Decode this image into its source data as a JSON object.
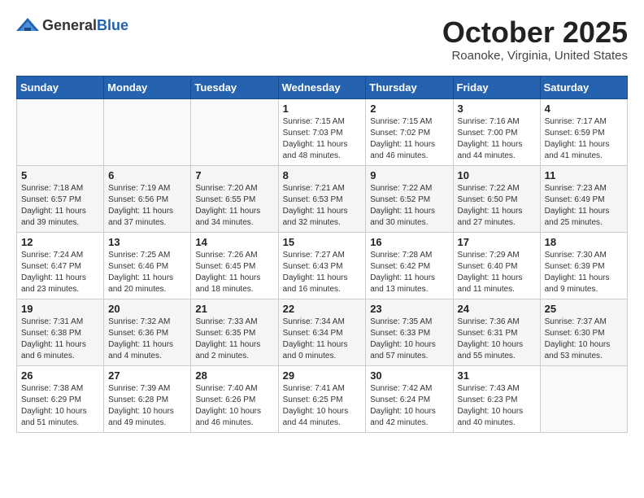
{
  "logo": {
    "general": "General",
    "blue": "Blue"
  },
  "title": "October 2025",
  "location": "Roanoke, Virginia, United States",
  "days_header": [
    "Sunday",
    "Monday",
    "Tuesday",
    "Wednesday",
    "Thursday",
    "Friday",
    "Saturday"
  ],
  "weeks": [
    [
      {
        "day": "",
        "sunrise": "",
        "sunset": "",
        "daylight": ""
      },
      {
        "day": "",
        "sunrise": "",
        "sunset": "",
        "daylight": ""
      },
      {
        "day": "",
        "sunrise": "",
        "sunset": "",
        "daylight": ""
      },
      {
        "day": "1",
        "sunrise": "Sunrise: 7:15 AM",
        "sunset": "Sunset: 7:03 PM",
        "daylight": "Daylight: 11 hours and 48 minutes."
      },
      {
        "day": "2",
        "sunrise": "Sunrise: 7:15 AM",
        "sunset": "Sunset: 7:02 PM",
        "daylight": "Daylight: 11 hours and 46 minutes."
      },
      {
        "day": "3",
        "sunrise": "Sunrise: 7:16 AM",
        "sunset": "Sunset: 7:00 PM",
        "daylight": "Daylight: 11 hours and 44 minutes."
      },
      {
        "day": "4",
        "sunrise": "Sunrise: 7:17 AM",
        "sunset": "Sunset: 6:59 PM",
        "daylight": "Daylight: 11 hours and 41 minutes."
      }
    ],
    [
      {
        "day": "5",
        "sunrise": "Sunrise: 7:18 AM",
        "sunset": "Sunset: 6:57 PM",
        "daylight": "Daylight: 11 hours and 39 minutes."
      },
      {
        "day": "6",
        "sunrise": "Sunrise: 7:19 AM",
        "sunset": "Sunset: 6:56 PM",
        "daylight": "Daylight: 11 hours and 37 minutes."
      },
      {
        "day": "7",
        "sunrise": "Sunrise: 7:20 AM",
        "sunset": "Sunset: 6:55 PM",
        "daylight": "Daylight: 11 hours and 34 minutes."
      },
      {
        "day": "8",
        "sunrise": "Sunrise: 7:21 AM",
        "sunset": "Sunset: 6:53 PM",
        "daylight": "Daylight: 11 hours and 32 minutes."
      },
      {
        "day": "9",
        "sunrise": "Sunrise: 7:22 AM",
        "sunset": "Sunset: 6:52 PM",
        "daylight": "Daylight: 11 hours and 30 minutes."
      },
      {
        "day": "10",
        "sunrise": "Sunrise: 7:22 AM",
        "sunset": "Sunset: 6:50 PM",
        "daylight": "Daylight: 11 hours and 27 minutes."
      },
      {
        "day": "11",
        "sunrise": "Sunrise: 7:23 AM",
        "sunset": "Sunset: 6:49 PM",
        "daylight": "Daylight: 11 hours and 25 minutes."
      }
    ],
    [
      {
        "day": "12",
        "sunrise": "Sunrise: 7:24 AM",
        "sunset": "Sunset: 6:47 PM",
        "daylight": "Daylight: 11 hours and 23 minutes."
      },
      {
        "day": "13",
        "sunrise": "Sunrise: 7:25 AM",
        "sunset": "Sunset: 6:46 PM",
        "daylight": "Daylight: 11 hours and 20 minutes."
      },
      {
        "day": "14",
        "sunrise": "Sunrise: 7:26 AM",
        "sunset": "Sunset: 6:45 PM",
        "daylight": "Daylight: 11 hours and 18 minutes."
      },
      {
        "day": "15",
        "sunrise": "Sunrise: 7:27 AM",
        "sunset": "Sunset: 6:43 PM",
        "daylight": "Daylight: 11 hours and 16 minutes."
      },
      {
        "day": "16",
        "sunrise": "Sunrise: 7:28 AM",
        "sunset": "Sunset: 6:42 PM",
        "daylight": "Daylight: 11 hours and 13 minutes."
      },
      {
        "day": "17",
        "sunrise": "Sunrise: 7:29 AM",
        "sunset": "Sunset: 6:40 PM",
        "daylight": "Daylight: 11 hours and 11 minutes."
      },
      {
        "day": "18",
        "sunrise": "Sunrise: 7:30 AM",
        "sunset": "Sunset: 6:39 PM",
        "daylight": "Daylight: 11 hours and 9 minutes."
      }
    ],
    [
      {
        "day": "19",
        "sunrise": "Sunrise: 7:31 AM",
        "sunset": "Sunset: 6:38 PM",
        "daylight": "Daylight: 11 hours and 6 minutes."
      },
      {
        "day": "20",
        "sunrise": "Sunrise: 7:32 AM",
        "sunset": "Sunset: 6:36 PM",
        "daylight": "Daylight: 11 hours and 4 minutes."
      },
      {
        "day": "21",
        "sunrise": "Sunrise: 7:33 AM",
        "sunset": "Sunset: 6:35 PM",
        "daylight": "Daylight: 11 hours and 2 minutes."
      },
      {
        "day": "22",
        "sunrise": "Sunrise: 7:34 AM",
        "sunset": "Sunset: 6:34 PM",
        "daylight": "Daylight: 11 hours and 0 minutes."
      },
      {
        "day": "23",
        "sunrise": "Sunrise: 7:35 AM",
        "sunset": "Sunset: 6:33 PM",
        "daylight": "Daylight: 10 hours and 57 minutes."
      },
      {
        "day": "24",
        "sunrise": "Sunrise: 7:36 AM",
        "sunset": "Sunset: 6:31 PM",
        "daylight": "Daylight: 10 hours and 55 minutes."
      },
      {
        "day": "25",
        "sunrise": "Sunrise: 7:37 AM",
        "sunset": "Sunset: 6:30 PM",
        "daylight": "Daylight: 10 hours and 53 minutes."
      }
    ],
    [
      {
        "day": "26",
        "sunrise": "Sunrise: 7:38 AM",
        "sunset": "Sunset: 6:29 PM",
        "daylight": "Daylight: 10 hours and 51 minutes."
      },
      {
        "day": "27",
        "sunrise": "Sunrise: 7:39 AM",
        "sunset": "Sunset: 6:28 PM",
        "daylight": "Daylight: 10 hours and 49 minutes."
      },
      {
        "day": "28",
        "sunrise": "Sunrise: 7:40 AM",
        "sunset": "Sunset: 6:26 PM",
        "daylight": "Daylight: 10 hours and 46 minutes."
      },
      {
        "day": "29",
        "sunrise": "Sunrise: 7:41 AM",
        "sunset": "Sunset: 6:25 PM",
        "daylight": "Daylight: 10 hours and 44 minutes."
      },
      {
        "day": "30",
        "sunrise": "Sunrise: 7:42 AM",
        "sunset": "Sunset: 6:24 PM",
        "daylight": "Daylight: 10 hours and 42 minutes."
      },
      {
        "day": "31",
        "sunrise": "Sunrise: 7:43 AM",
        "sunset": "Sunset: 6:23 PM",
        "daylight": "Daylight: 10 hours and 40 minutes."
      },
      {
        "day": "",
        "sunrise": "",
        "sunset": "",
        "daylight": ""
      }
    ]
  ]
}
